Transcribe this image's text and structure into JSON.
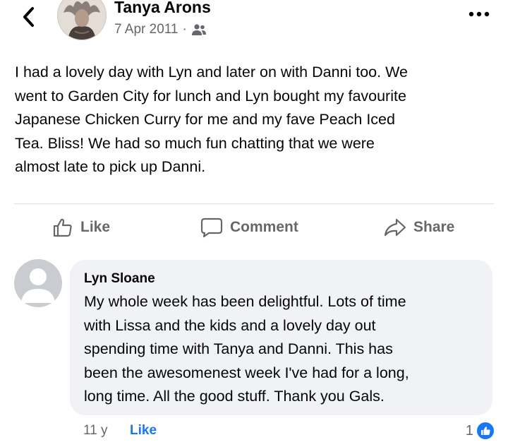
{
  "post": {
    "author": "Tanya Arons",
    "date": "7 Apr 2011",
    "separator": "·",
    "audience_icon": "friends-icon",
    "text": "I had a lovely day with Lyn and later on with Danni too.  We\nwent to Garden City for lunch and Lyn bought my favourite\nJapanese Chicken Curry for me and my fave Peach Iced\nTea.  Bliss!  We had so much fun chatting that we were\nalmost late to pick up Danni."
  },
  "actions": {
    "like": "Like",
    "comment": "Comment",
    "share": "Share"
  },
  "comment": {
    "author": "Lyn Sloane",
    "text": "My whole week has been delightful.  Lots of time\nwith Lissa and the kids and a lovely day out\nspending time with Tanya and Danni.  This has\nbeen the awesomenest week I've had for a long,\nlong time.  All the good stuff. Thank you Gals.",
    "time": "11 y",
    "like_label": "Like",
    "reaction_count": "1"
  },
  "colors": {
    "accent": "#1877f2",
    "secondary_text": "#65676b",
    "bubble": "#f0f2f5"
  }
}
